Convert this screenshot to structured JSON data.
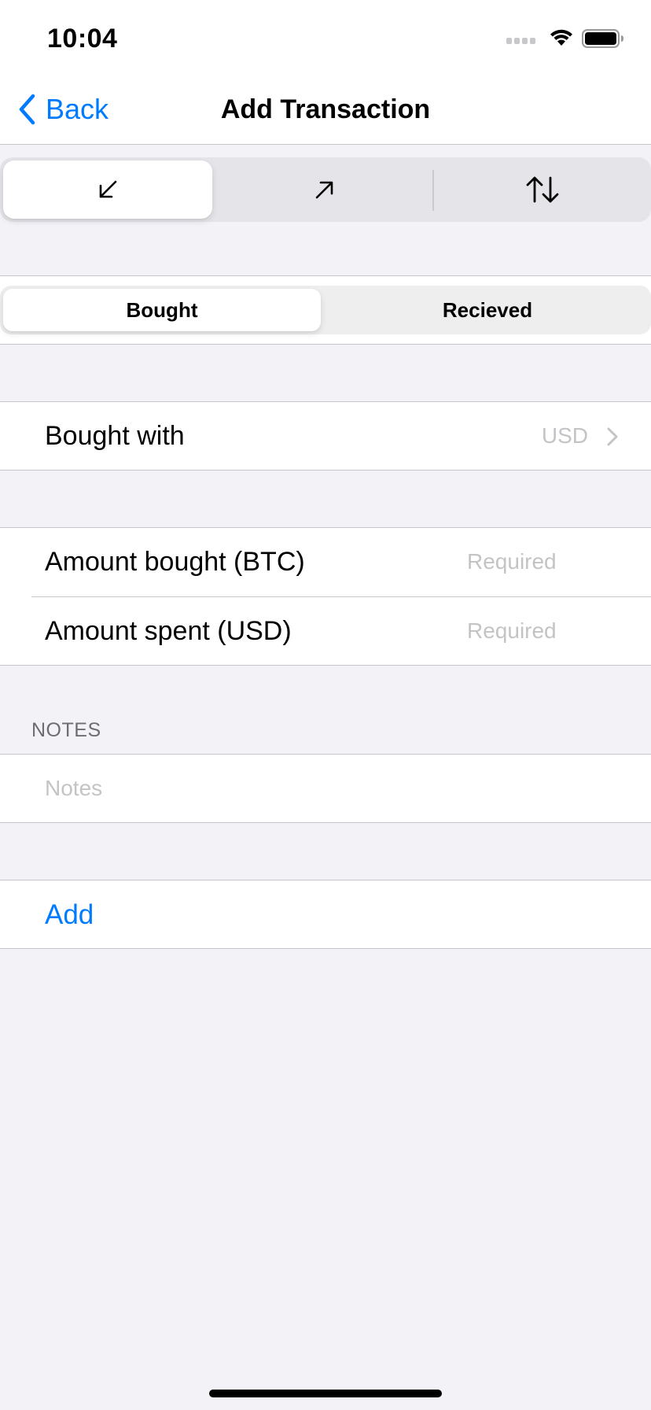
{
  "status_bar": {
    "time": "10:04"
  },
  "nav": {
    "back_label": "Back",
    "title": "Add Transaction"
  },
  "type_segments": [
    {
      "icon": "arrow-down-left-icon",
      "selected": true
    },
    {
      "icon": "arrow-up-right-icon",
      "selected": false
    },
    {
      "icon": "arrow-up-down-icon",
      "selected": false
    }
  ],
  "mode_segments": [
    {
      "label": "Bought",
      "selected": true
    },
    {
      "label": "Recieved",
      "selected": false
    }
  ],
  "bought_with": {
    "label": "Bought with",
    "value": "USD"
  },
  "amounts": [
    {
      "label": "Amount bought (BTC)",
      "placeholder": "Required"
    },
    {
      "label": "Amount spent (USD)",
      "placeholder": "Required"
    }
  ],
  "notes": {
    "header": "NOTES",
    "placeholder": "Notes"
  },
  "add_label": "Add",
  "colors": {
    "accent": "#007aff",
    "background": "#f2f2f7",
    "placeholder": "#c4c4c7"
  }
}
